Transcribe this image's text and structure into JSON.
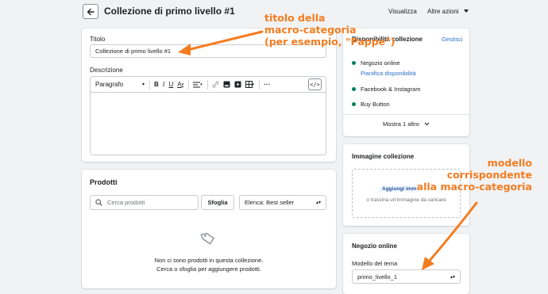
{
  "header": {
    "title": "Collezione di primo livello #1",
    "view_label": "Visualizza",
    "more_actions_label": "Altre azioni"
  },
  "main_card": {
    "title_label": "Titolo",
    "title_value": "Collezione di primo livello #1",
    "description_label": "Descrizione",
    "format_select": "Paragrafo"
  },
  "products_card": {
    "heading": "Prodotti",
    "search_placeholder": "Cerca prodotti",
    "browse_label": "Sfoglia",
    "sort_select": "Elenca: Best seller",
    "empty_line1": "Non ci sono prodotti in questa collezione.",
    "empty_line2": "Cerca o sfoglia per aggiungere prodotti."
  },
  "availability_card": {
    "heading": "Disponibilità collezione",
    "manage_label": "Gestisci",
    "channels": [
      {
        "name": "Negozio online",
        "link": "Pianifica disponibilità"
      },
      {
        "name": "Facebook & Instagram"
      },
      {
        "name": "Buy Button"
      }
    ],
    "show_more_label": "Mostra 1 altro"
  },
  "image_card": {
    "heading": "Immagine collezione",
    "add_image_label": "Aggiungi imm",
    "drop_hint": "o trascina un'immagine da caricare"
  },
  "online_store_card": {
    "heading": "Negozio online",
    "template_label": "Modello del tema",
    "template_value": "primo_livello_1"
  },
  "annotations": {
    "title_note_l1": "titolo della",
    "title_note_l2": "macro-categoria",
    "title_note_l3": "(per esempio, \"Pappe\")",
    "template_note_l1": "modello",
    "template_note_l2": "corrispondente",
    "template_note_l3": "alla macro-categoria"
  },
  "colors": {
    "accent_annotation": "#f47c20",
    "status_green": "#008060",
    "link_blue": "#2c6ecb"
  }
}
